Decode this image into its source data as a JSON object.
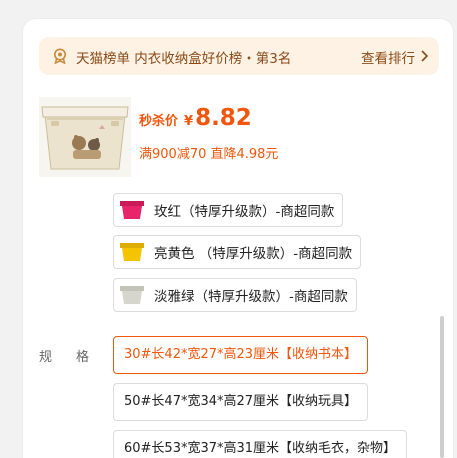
{
  "rank": {
    "text": "天猫榜单 内衣收纳盒好价榜・第3名",
    "link": "查看排行",
    "icon": "award-medal-icon",
    "chevron": "chevron-right-icon"
  },
  "product": {
    "image": "storage-box-product-image",
    "price_label": "秒杀价",
    "price_symbol": "¥",
    "price_value": "8.82",
    "promo": "满900减70 直降4.98元",
    "accent_color": "#f2560c"
  },
  "colors": [
    {
      "label": "玫红（特厚升级款）-商超同款",
      "swatch": "#e8246a"
    },
    {
      "label": "亮黄色 （特厚升级款）-商超同款",
      "swatch": "#f5c400"
    },
    {
      "label": "淡雅绿（特厚升级款）-商超同款",
      "swatch": "#d7d6cc"
    }
  ],
  "spec": {
    "label": "规格",
    "options": [
      "30#长42*宽27*高23厘米【收纳书本】",
      "50#长47*宽34*高27厘米【收纳玩具】",
      "60#长53*宽37*高31厘米【收纳毛衣，杂物】"
    ],
    "selected_index": 0
  }
}
